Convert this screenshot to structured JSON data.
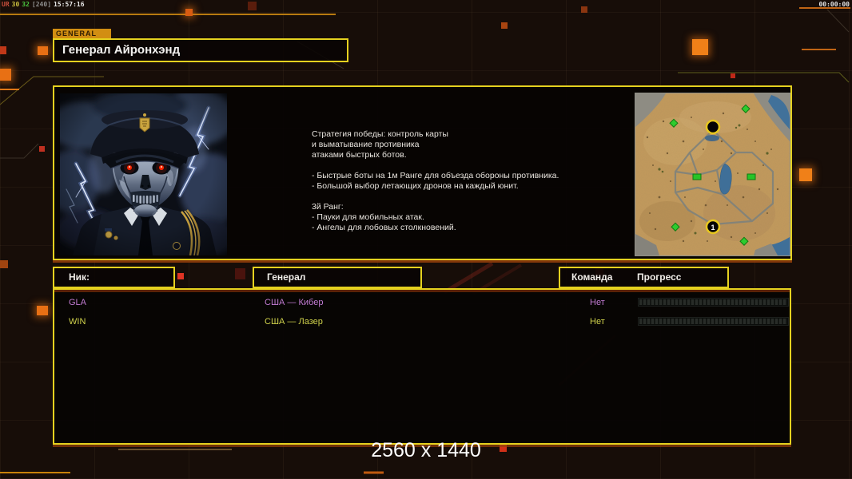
{
  "hud": {
    "debug": [
      {
        "text": "UR",
        "color": "#c94f3c"
      },
      {
        "text": "30",
        "color": "#c9bd3f"
      },
      {
        "text": "32",
        "color": "#49c43f"
      },
      {
        "text": "[240]",
        "color": "#8f8f8f"
      },
      {
        "text": "15:57:16",
        "color": "#e6e6e6"
      }
    ],
    "match_timer": "00:00:00",
    "resolution_label": "2560 x 1440"
  },
  "general_screen": {
    "tab_label": "GENERAL",
    "title": "Генерал Айронхэнд",
    "strategy": "Стратегия победы: контроль карты\nи выматывание противника\nатаками быстрых ботов.\n\n- Быстрые боты на 1м Ранге для объезда обороны противника.\n- Большой выбор летающих дронов на каждый юнит.\n\n3й Ранг:\n- Пауки для мобильных атак.\n- Ангелы для лобовых столкновений.",
    "minimap": {
      "player_marker": "1"
    }
  },
  "players": {
    "headers": {
      "nick": "Ник:",
      "general": "Генерал",
      "team": "Команда",
      "progress": "Прогресс"
    },
    "rows": [
      {
        "nick": "GLA",
        "general": "США — Кибер",
        "team": "Нет",
        "progress_percent": 0
      },
      {
        "nick": "WIN",
        "general": "США — Лазер",
        "team": "Нет",
        "progress_percent": 0
      }
    ]
  },
  "colors": {
    "accent_yellow": "#e5d11f",
    "accent_orange": "#cf6a14",
    "tab_background": "#d28e12",
    "row_gla": "#c17bd1",
    "row_win": "#d0d24c",
    "eye_red": "#ff2400",
    "minimap_sand": "#c39a5d",
    "minimap_road": "#82837a",
    "minimap_green": "#2ecc2e",
    "minimap_water": "#3f6f98"
  }
}
